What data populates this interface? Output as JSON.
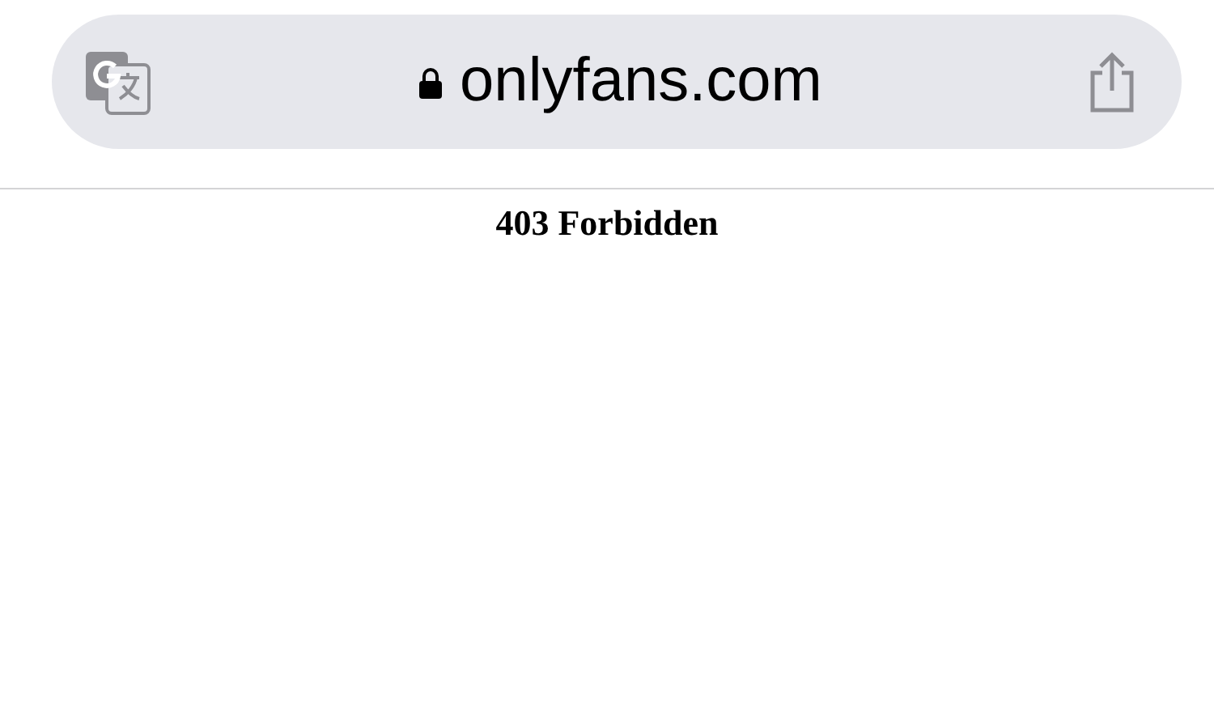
{
  "address_bar": {
    "url": "onlyfans.com",
    "secure": true
  },
  "page": {
    "heading": "403 Forbidden"
  }
}
